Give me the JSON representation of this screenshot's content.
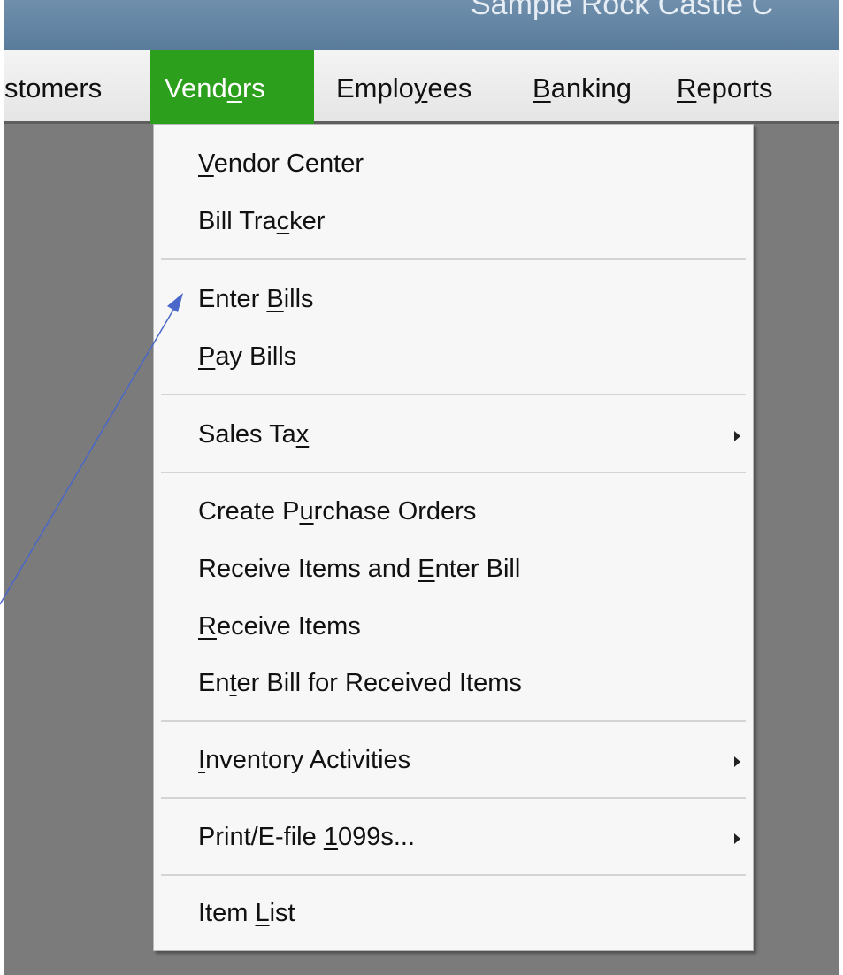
{
  "window": {
    "title": "Sample Rock Castle C"
  },
  "menubar": {
    "items": [
      {
        "pre": "stomers",
        "ul": "",
        "post": ""
      },
      {
        "pre": "Vend",
        "ul": "o",
        "post": "rs"
      },
      {
        "pre": "Emplo",
        "ul": "y",
        "post": "ees"
      },
      {
        "pre": "",
        "ul": "B",
        "post": "anking"
      },
      {
        "pre": "",
        "ul": "R",
        "post": "eports"
      }
    ],
    "active": "Vendors"
  },
  "vendors_menu": {
    "items": [
      {
        "pre": "",
        "ul": "V",
        "post": "endor Center"
      },
      {
        "pre": "Bill Tra",
        "ul": "c",
        "post": "ker"
      },
      {
        "pre": "Enter ",
        "ul": "B",
        "post": "ills"
      },
      {
        "pre": "",
        "ul": "P",
        "post": "ay Bills"
      },
      {
        "pre": "Sales Ta",
        "ul": "x",
        "post": ""
      },
      {
        "pre": "Create P",
        "ul": "u",
        "post": "rchase Orders"
      },
      {
        "pre": "Receive Items and ",
        "ul": "E",
        "post": "nter Bill"
      },
      {
        "pre": "",
        "ul": "R",
        "post": "eceive Items"
      },
      {
        "pre": "En",
        "ul": "t",
        "post": "er Bill for Received Items"
      },
      {
        "pre": "",
        "ul": "I",
        "post": "nventory Activities"
      },
      {
        "pre": "Print/E-file ",
        "ul": "1",
        "post": "099s..."
      },
      {
        "pre": "Item ",
        "ul": "L",
        "post": "ist"
      }
    ]
  },
  "colors": {
    "active_menu": "#2ca01c",
    "annotation_arrow": "#4a67c9",
    "titlebar": "#5f81a0",
    "workspace": "#7b7b7b"
  }
}
